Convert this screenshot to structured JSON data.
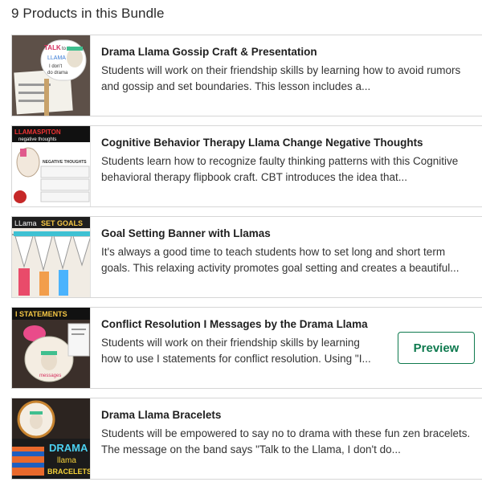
{
  "bundle": {
    "heading": "9 Products in this Bundle"
  },
  "products": [
    {
      "title": "Drama Llama Gossip Craft & Presentation",
      "description": "Students will work on their friendship skills by learning how to avoid rumors and gossip and set boundaries. This lesson includes a...",
      "thumb_text": [
        "TALK",
        "to the",
        "LLAMA",
        "I don't",
        "do drama"
      ]
    },
    {
      "title": "Cognitive Behavior Therapy Llama Change Negative Thoughts",
      "description": "Students learn how to recognize faulty thinking patterns with this Cognitive behavioral therapy flipbook craft. CBT introduces the idea that...",
      "thumb_text": [
        "LLAMASPITON",
        "negative thoughts",
        "NEGATIVE THOUGHTS"
      ]
    },
    {
      "title": "Goal Setting Banner with Llamas",
      "description": "It's always a good time to teach students how to set long and short term goals. This relaxing activity promotes goal setting and creates a beautiful...",
      "thumb_text": [
        "LLama",
        "SET GOALS"
      ]
    },
    {
      "title": "Conflict Resolution I Messages by the Drama Llama",
      "description": "Students will work on their friendship skills by learning how to use I statements for conflict resolution. Using \"I...",
      "thumb_text": [
        "I STATEMENTS",
        "messages"
      ],
      "preview_label": "Preview"
    },
    {
      "title": "Drama Llama Bracelets",
      "description": "Students will be empowered to say no to drama with these fun zen bracelets. The message on the band says \"Talk to the Llama, I don't do...",
      "thumb_text": [
        "DRAMA",
        "llama",
        "BRACELETS"
      ]
    }
  ],
  "colors": {
    "accent": "#0f7a4f",
    "border": "#d6d6d6",
    "text": "#1f1f1f"
  }
}
